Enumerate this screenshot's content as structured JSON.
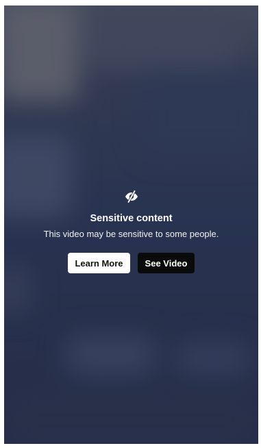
{
  "sensitive_notice": {
    "icon": "eye-slash-icon",
    "title": "Sensitive content",
    "message": "This video may be sensitive to some people.",
    "learn_more_label": "Learn More",
    "see_video_label": "See Video"
  },
  "colors": {
    "primary_button_bg": "#ffffff",
    "secondary_button_bg": "#0a0a0a",
    "text": "#ffffff"
  }
}
